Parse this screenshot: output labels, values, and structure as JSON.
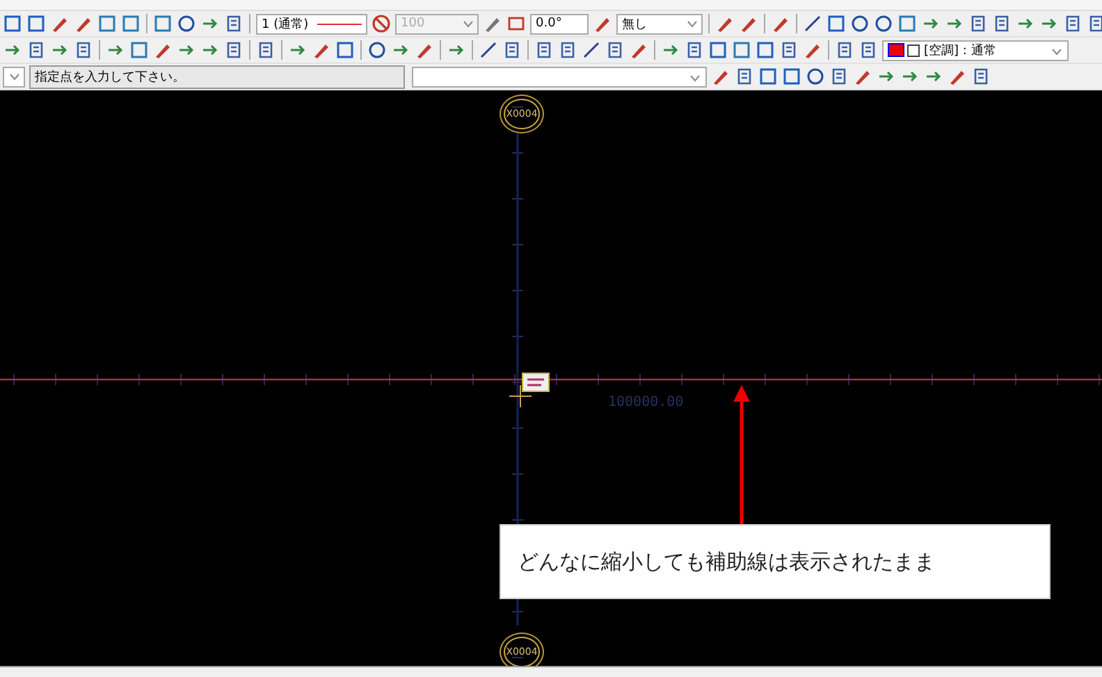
{
  "toolbar1": {
    "line_style": "1 (通常)",
    "width": {
      "value": "100",
      "disabled": true
    },
    "angle": "0.0°",
    "fill": "無し"
  },
  "toolbar2": {
    "layer": "[空調] : 通常"
  },
  "command": {
    "prompt": "指定点を入力して下さい。"
  },
  "canvas": {
    "grid_markers": [
      {
        "label": "X0004"
      },
      {
        "label": "X0004"
      }
    ],
    "dimension": "100000.00",
    "callout": "どんなに縮小しても補助線は表示されたまま"
  }
}
